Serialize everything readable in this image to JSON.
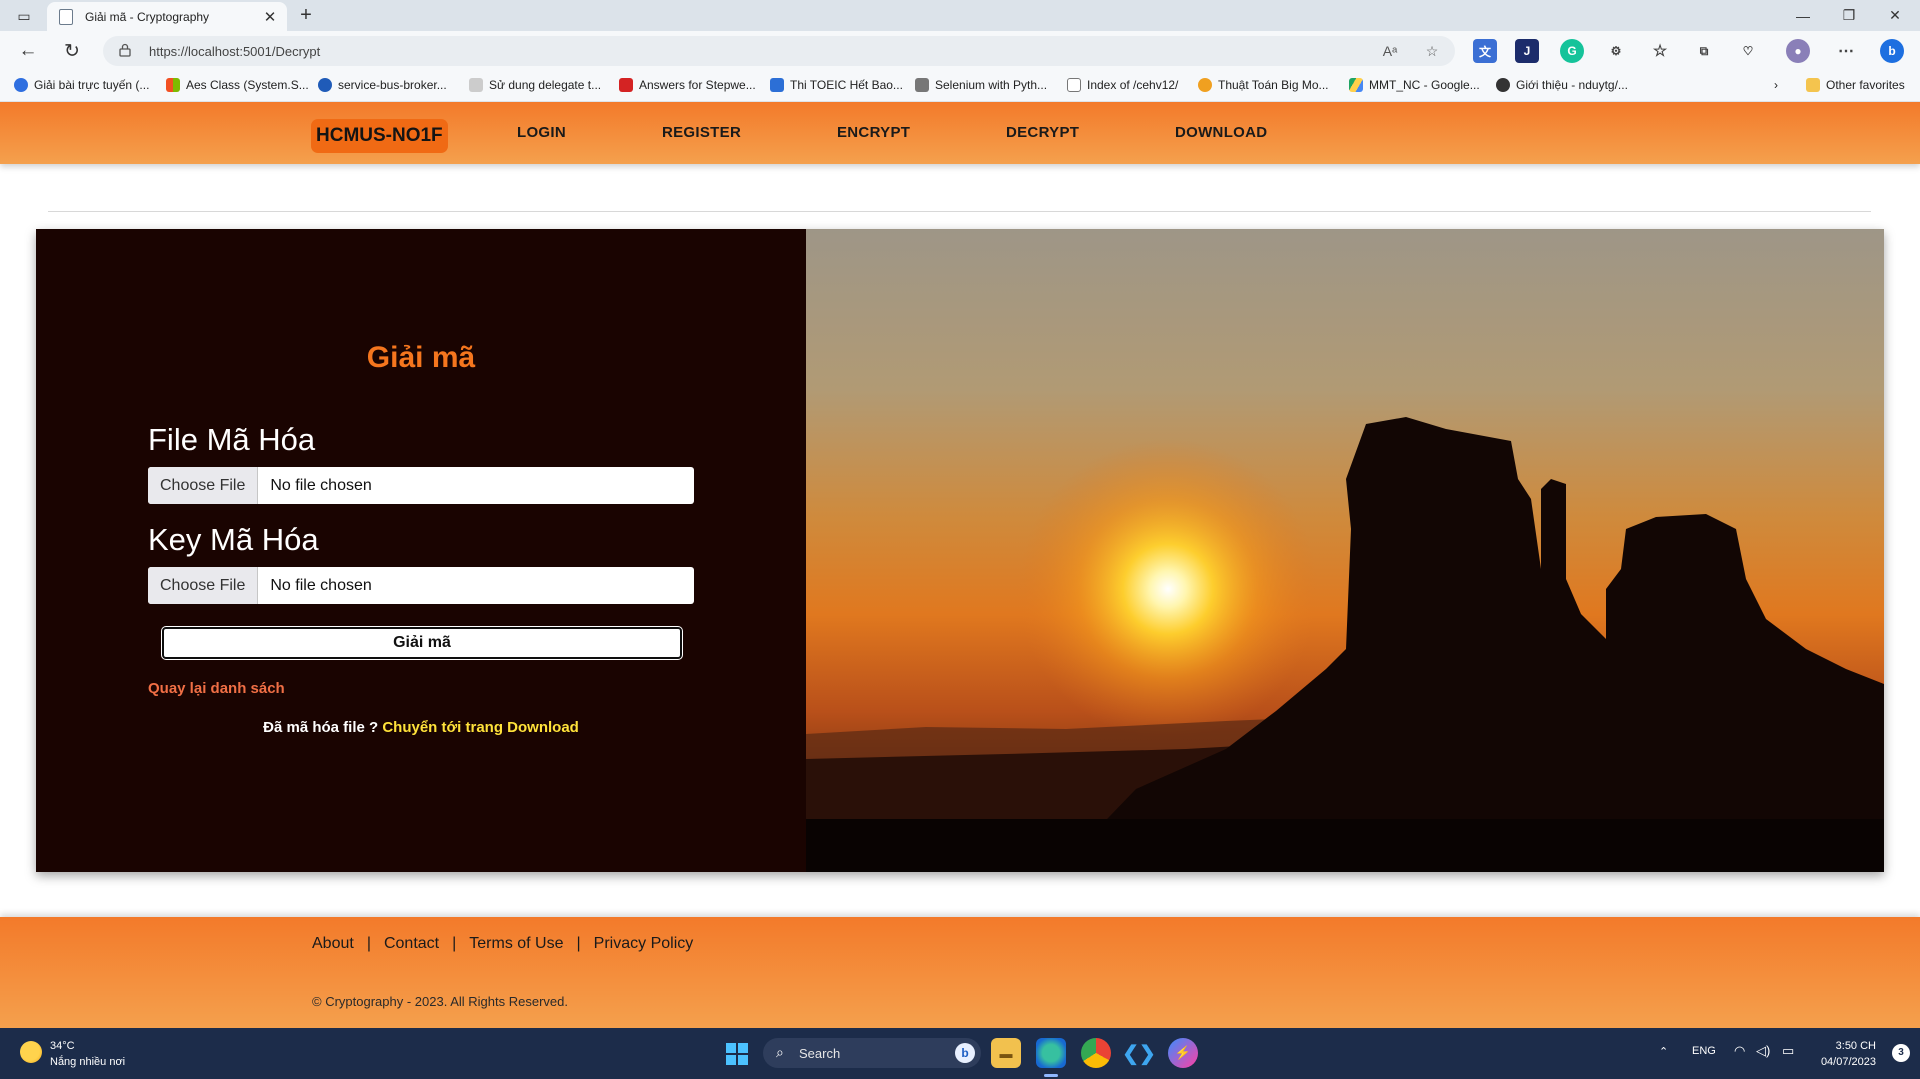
{
  "browser": {
    "tab_title": "Giải mã - Cryptography",
    "new_tab": "+",
    "url": "https://localhost:5001/Decrypt",
    "window_controls": [
      "—",
      "❐",
      "✕"
    ],
    "favorites": [
      {
        "label": "Giải bài trực tuyến (...",
        "color": "#2f6fe0"
      },
      {
        "label": "Aes Class (System.S...",
        "color": "#e34b2b"
      },
      {
        "label": "service-bus-broker...",
        "color": "#1f5bb8"
      },
      {
        "label": "Sử dung delegate t...",
        "color": "#bbbbbb"
      },
      {
        "label": "Answers for Stepwe...",
        "color": "#d42323"
      },
      {
        "label": "Thi TOEIC Hết Bao...",
        "color": "#2c6fd6"
      },
      {
        "label": "Selenium with Pyth...",
        "color": "#555555"
      },
      {
        "label": "Index of /cehv12/",
        "color": "#777777"
      },
      {
        "label": "Thuật Toán Big Mo...",
        "color": "#f0a020"
      },
      {
        "label": "MMT_NC - Google...",
        "color": "#1fa463"
      },
      {
        "label": "Giới thiệu - nduytg/...",
        "color": "#333333"
      }
    ],
    "other_favorites": "Other favorites"
  },
  "site": {
    "brand": "HCMUS-NO1F",
    "nav": [
      "LOGIN",
      "REGISTER",
      "ENCRYPT",
      "DECRYPT",
      "DOWNLOAD"
    ]
  },
  "form": {
    "title": "Giải mã",
    "file_label": "File Mã Hóa",
    "key_label": "Key Mã Hóa",
    "choose_file": "Choose File",
    "no_file": "No file chosen",
    "submit": "Giải mã",
    "back_link": "Quay lại danh sách",
    "note_prefix": "Đã mã hóa file ? ",
    "note_link": "Chuyển tới trang Download"
  },
  "footer": {
    "links": [
      "About",
      "Contact",
      "Terms of Use",
      "Privacy Policy"
    ],
    "separator": "|",
    "copyright": "© Cryptography - 2023. All Rights Reserved."
  },
  "taskbar": {
    "temperature": "34°C",
    "weather": "Nắng nhiều nơi",
    "search": "Search",
    "lang": "ENG",
    "time": "3:50 CH",
    "date": "04/07/2023",
    "notifications": "3"
  },
  "colors": {
    "accent_orange": "#f37a2a",
    "panel_dark": "#1a0401",
    "title_orange": "#f5761e",
    "link_yellow": "#ffe23a",
    "link_salmon": "#f06f45"
  }
}
